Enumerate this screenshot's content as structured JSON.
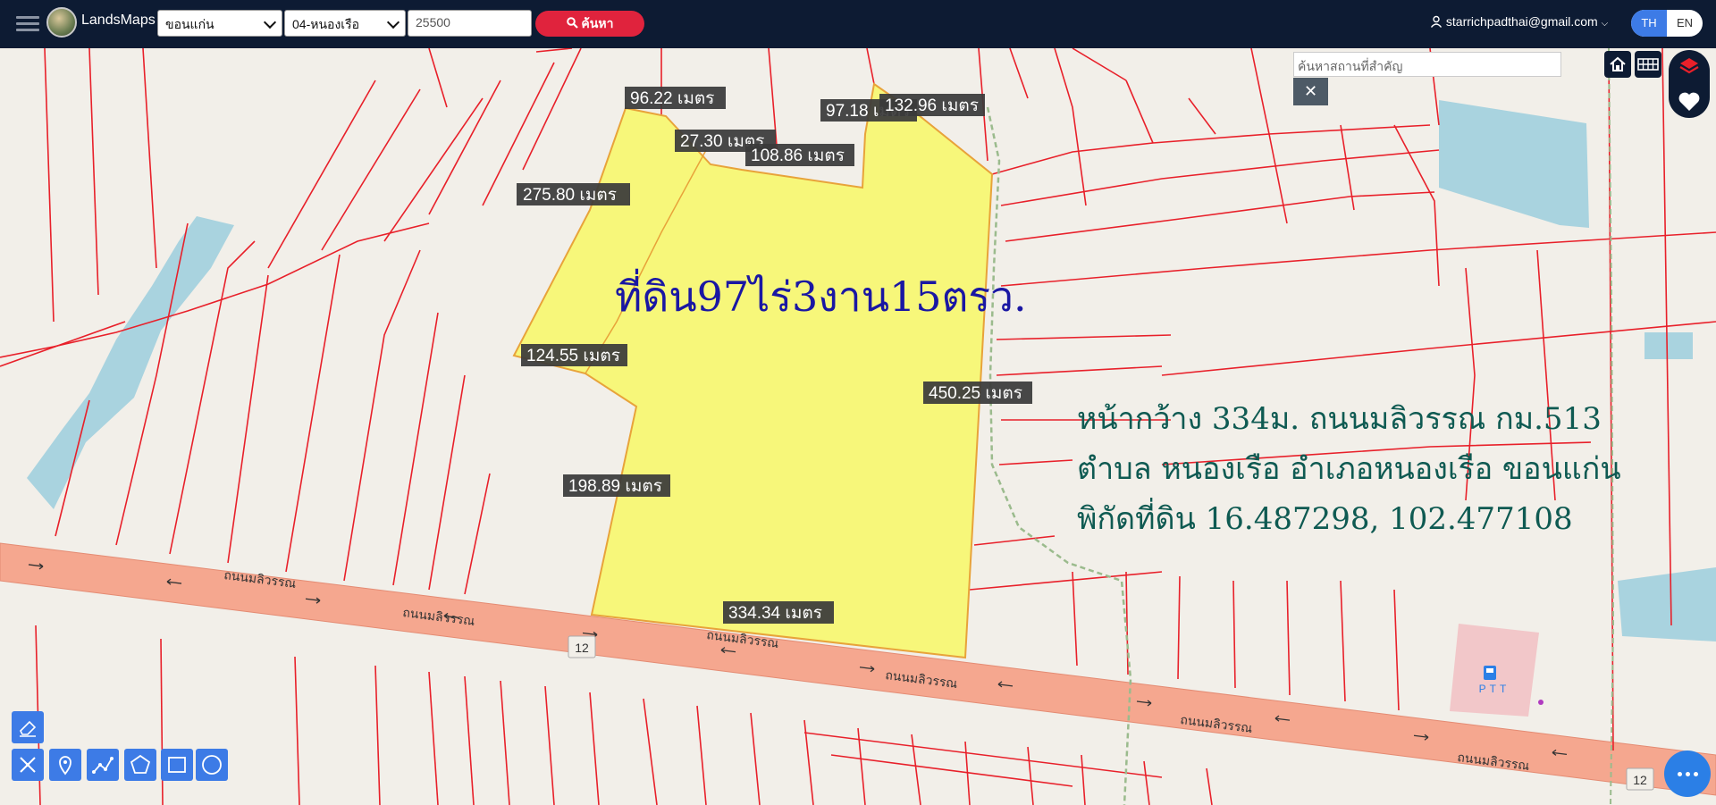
{
  "header": {
    "brand": "LandsMaps",
    "province": "ขอนแก่น",
    "district": "04-หนองเรือ",
    "zip": "25500",
    "search_label": "ค้นหา",
    "user_email": "starrichpadthai@gmail.com",
    "lang_th": "TH",
    "lang_en": "EN"
  },
  "place_search": {
    "placeholder": "ค้นหาสถานที่สำคัญ",
    "close_label": "✕"
  },
  "parcel": {
    "title": "ที่ดิน97ไร่3งาน15ตรว.",
    "info_line1": "หน้ากว้าง 334ม. ถนนมลิวรรณ กม.513",
    "info_line2": "ตำบล หนองเรือ อำเภอหนองเรือ ขอนแก่น",
    "info_line3": "พิกัดที่ดิน 16.487298, 102.477108",
    "measurements": [
      "96.22 เมตร",
      "97.18 เมตร",
      "132.96 เมตร",
      "27.30 เมตร",
      "108.86 เมตร",
      "275.80 เมตร",
      "124.55 เมตร",
      "450.25 เมตร",
      "198.89 เมตร",
      "334.34 เมตร"
    ]
  },
  "roads": {
    "name": "ถนนมลิวรรณ",
    "route_number": "12"
  },
  "poi": {
    "gas_station": "PTT"
  },
  "colors": {
    "parcel_fill": "#f7f77a",
    "parcel_outline": "#e8a33a",
    "road": "#f5a78f",
    "boundary": "#e8202a",
    "water": "#a9d3df",
    "title": "#1a17a3",
    "info": "#0f5a52"
  }
}
